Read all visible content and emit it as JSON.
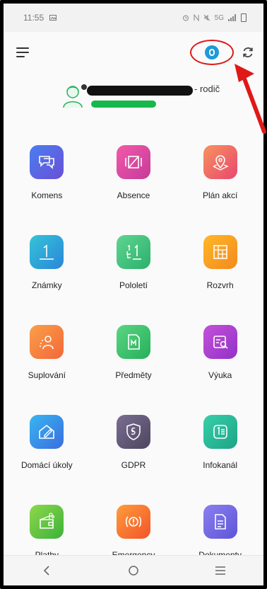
{
  "status_bar": {
    "time": "11:55",
    "icons": [
      "alarm-icon",
      "nfc-icon",
      "mute-icon",
      "5g-signal-icon",
      "battery-icon"
    ],
    "signal_text": "5G"
  },
  "app_bar": {
    "menu_icon": "menu-icon",
    "info_icon": "info-icon",
    "refresh_icon": "refresh-icon",
    "highlight_color": "#e01818"
  },
  "profile": {
    "role": "- rodič"
  },
  "tiles": [
    {
      "label": "Komens",
      "icon": "chat-icon",
      "colors": [
        "#4a7ef0",
        "#6a4fd6"
      ]
    },
    {
      "label": "Absence",
      "icon": "absence-icon",
      "colors": [
        "#f25aa8",
        "#c53b9a"
      ]
    },
    {
      "label": "Plán akcí",
      "icon": "map-pin-icon",
      "colors": [
        "#f7935f",
        "#e9466e"
      ]
    },
    {
      "label": "Známky",
      "icon": "grade-icon",
      "colors": [
        "#34c4d8",
        "#2a86d8"
      ]
    },
    {
      "label": "Pololetí",
      "icon": "fraction-icon",
      "colors": [
        "#5fd590",
        "#2bb06c"
      ]
    },
    {
      "label": "Rozvrh",
      "icon": "timetable-icon",
      "colors": [
        "#ffb72a",
        "#f38a1c"
      ]
    },
    {
      "label": "Suplování",
      "icon": "substitute-icon",
      "colors": [
        "#fb9f48",
        "#f2683a"
      ]
    },
    {
      "label": "Předměty",
      "icon": "subject-icon",
      "colors": [
        "#5bd583",
        "#25b05a"
      ]
    },
    {
      "label": "Výuka",
      "icon": "lesson-icon",
      "colors": [
        "#c451d9",
        "#9232c8"
      ]
    },
    {
      "label": "Domácí úkoly",
      "icon": "homework-icon",
      "colors": [
        "#38b6f0",
        "#3a6de0"
      ]
    },
    {
      "label": "GDPR",
      "icon": "shield-icon",
      "colors": [
        "#7a6e92",
        "#4e455f"
      ]
    },
    {
      "label": "Infokanál",
      "icon": "list-icon",
      "colors": [
        "#38cfa9",
        "#1da486"
      ]
    },
    {
      "label": "Platby",
      "icon": "wallet-icon",
      "colors": [
        "#8ed84a",
        "#3cb23a"
      ]
    },
    {
      "label": "Emergency",
      "icon": "alarm-icon",
      "colors": [
        "#ff9c3a",
        "#f2542a"
      ]
    },
    {
      "label": "Dokumenty",
      "icon": "document-icon",
      "colors": [
        "#8c7ff0",
        "#5d55d8"
      ]
    }
  ],
  "nav_bar": {
    "back_icon": "back-icon",
    "home_icon": "home-icon",
    "recents_icon": "recents-icon"
  }
}
